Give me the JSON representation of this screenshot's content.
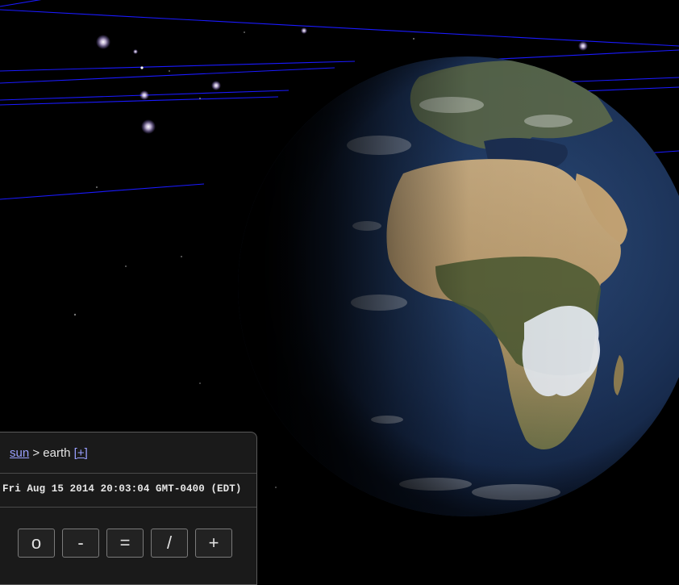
{
  "breadcrumb": {
    "parent": "sun",
    "separator": ">",
    "current": "earth",
    "expand": "[+]"
  },
  "datetime": "Fri Aug 15 2014 20:03:04 GMT-0400 (EDT)",
  "controls": {
    "o": "o",
    "minus": "-",
    "equals": "=",
    "slash": "/",
    "plus": "+"
  },
  "colors": {
    "space": "#000000",
    "orbit_line": "#1a1aff",
    "link": "#9aa0ff",
    "panel_bg": "#1a1a1a"
  }
}
